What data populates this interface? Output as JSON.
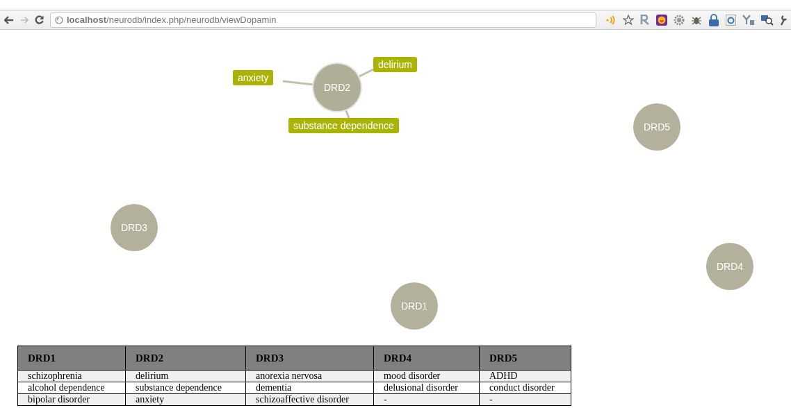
{
  "browser": {
    "url": "**localhost**/neurodb/index.php/neurodb/viewDopamin"
  },
  "graph": {
    "nodes": [
      {
        "label": "DRD2",
        "expanded": true,
        "children": [
          {
            "label": "anxiety"
          },
          {
            "label": "delirium"
          },
          {
            "label": "substance dependence"
          }
        ]
      },
      {
        "label": "DRD5",
        "expanded": false
      },
      {
        "label": "DRD3",
        "expanded": false
      },
      {
        "label": "DRD4",
        "expanded": false
      },
      {
        "label": "DRD1",
        "expanded": false
      }
    ]
  },
  "table": {
    "columns": [
      "DRD1",
      "DRD2",
      "DRD3",
      "DRD4",
      "DRD5"
    ],
    "rows": [
      [
        "schizophrenia",
        "delirium",
        "anorexia nervosa",
        "mood disorder",
        "ADHD"
      ],
      [
        "alcohol dependence",
        "substance dependence",
        "dementia",
        "delusional disorder",
        "conduct disorder"
      ],
      [
        "bipolar disorder",
        "anxiety",
        "schizoaffective disorder",
        "-",
        "-"
      ]
    ]
  }
}
